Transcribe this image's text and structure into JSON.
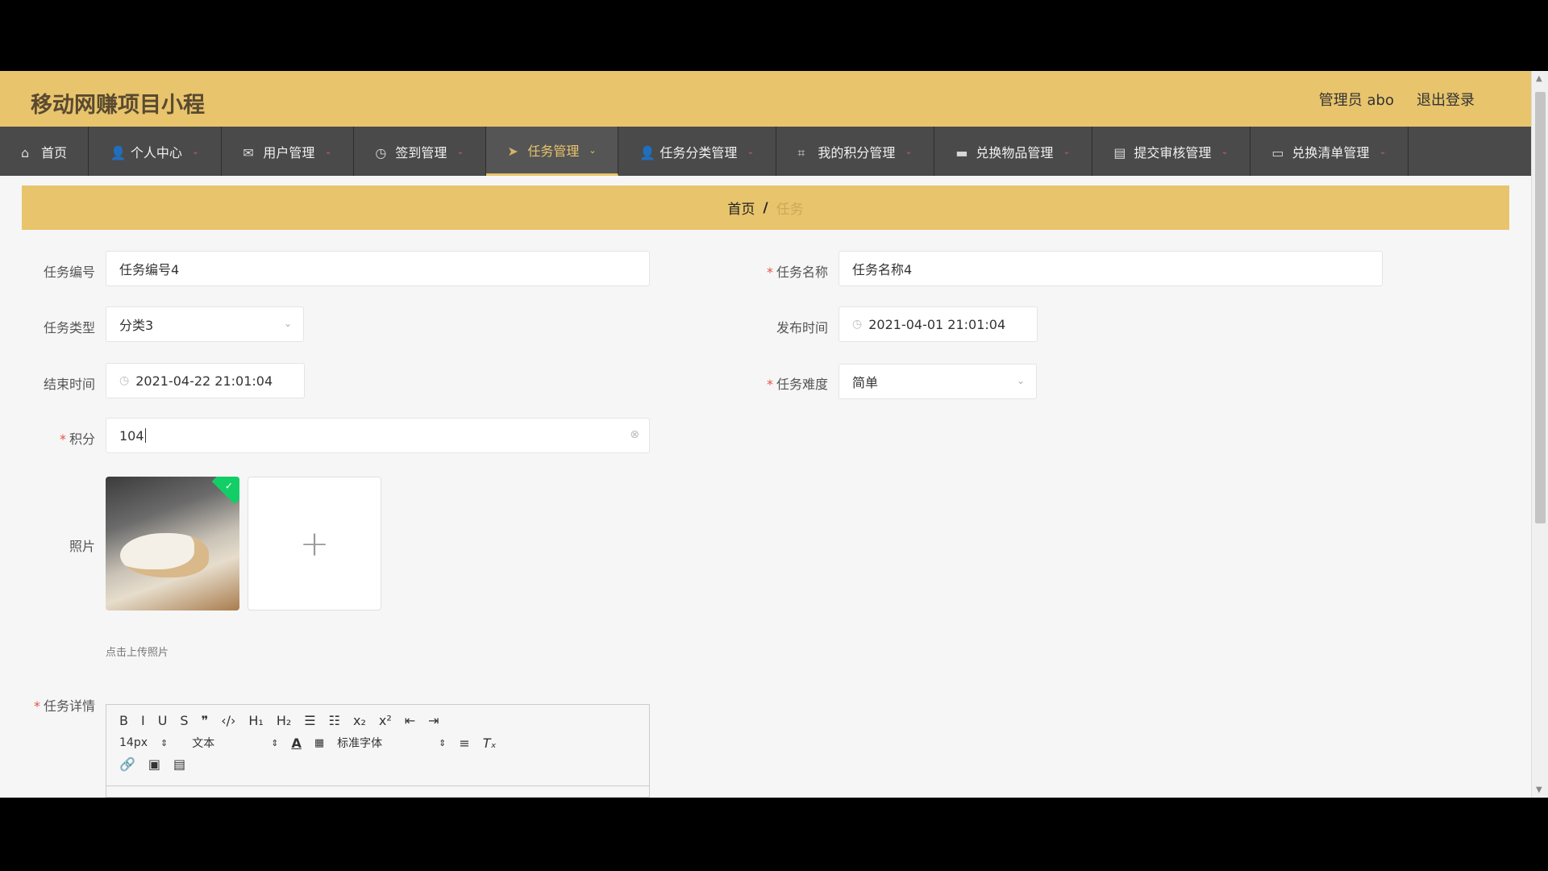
{
  "header": {
    "title": "移动网赚项目小程",
    "admin": "管理员 abo",
    "logout": "退出登录"
  },
  "nav": [
    {
      "label": "首页",
      "icon": "home-icon",
      "active": false,
      "chevron": false
    },
    {
      "label": "个人中心",
      "icon": "user-icon",
      "active": false,
      "chevron": true
    },
    {
      "label": "用户管理",
      "icon": "mail-icon",
      "active": false,
      "chevron": true
    },
    {
      "label": "签到管理",
      "icon": "compass-icon",
      "active": false,
      "chevron": true
    },
    {
      "label": "任务管理",
      "icon": "send-icon",
      "active": true,
      "chevron": true
    },
    {
      "label": "任务分类管理",
      "icon": "user-icon",
      "active": false,
      "chevron": true
    },
    {
      "label": "我的积分管理",
      "icon": "crop-icon",
      "active": false,
      "chevron": true
    },
    {
      "label": "兑换物品管理",
      "icon": "briefcase-icon",
      "active": false,
      "chevron": true
    },
    {
      "label": "提交审核管理",
      "icon": "clipboard-icon",
      "active": false,
      "chevron": true
    },
    {
      "label": "兑换清单管理",
      "icon": "monitor-icon",
      "active": false,
      "chevron": true
    }
  ],
  "breadcrumb": {
    "home": "首页",
    "separator": "/",
    "current": "任务"
  },
  "form": {
    "task_no": {
      "label": "任务编号",
      "value": "任务编号4"
    },
    "task_name": {
      "label": "任务名称",
      "value": "任务名称4",
      "required": "*"
    },
    "task_type": {
      "label": "任务类型",
      "value": "分类3"
    },
    "publish_time": {
      "label": "发布时间",
      "value": "2021-04-01 21:01:04"
    },
    "end_time": {
      "label": "结束时间",
      "value": "2021-04-22 21:01:04"
    },
    "difficulty": {
      "label": "任务难度",
      "value": "简单",
      "required": "*"
    },
    "points": {
      "label": "积分",
      "value": "104",
      "required": "*"
    },
    "photo": {
      "label": "照片",
      "hint": "点击上传照片",
      "add": "+"
    },
    "detail": {
      "label": "任务详情",
      "required": "*"
    }
  },
  "editor": {
    "row1": [
      "B",
      "I",
      "U",
      "S",
      "❞",
      "‹/›",
      "H₁",
      "H₂",
      "☰",
      "☷",
      "x₂",
      "x²",
      "⇤",
      "⇥"
    ],
    "row2": {
      "size": "14px",
      "text": "文本",
      "font": "标准字体"
    },
    "row3": [
      "🔗",
      "▣",
      "▤"
    ]
  },
  "colors": {
    "accent": "#e8c46c",
    "nav_bg": "#4a4a4a",
    "required": "#e5534b"
  }
}
